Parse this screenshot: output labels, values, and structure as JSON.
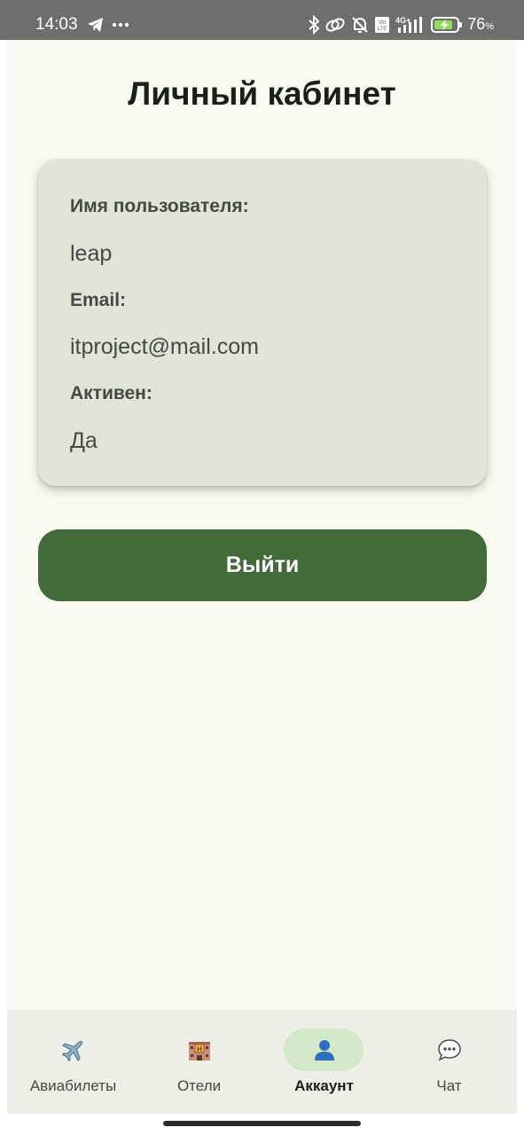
{
  "status_bar": {
    "time": "14:03",
    "left_icons": [
      "telegram-icon",
      "more-dots-icon"
    ],
    "right_icons": [
      "bluetooth-icon",
      "link-icon",
      "notifications-off-icon",
      "volte-icon",
      "signal-4g-icon",
      "battery-charging-icon"
    ],
    "network_badge": "4G+",
    "volte_badge": "Vo LTE",
    "battery_percent": "76",
    "battery_percent_sign": "%"
  },
  "page": {
    "title": "Личный кабинет"
  },
  "profile": {
    "username_label": "Имя пользователя:",
    "username_value": "leap",
    "email_label": "Email:",
    "email_value": "itproject@mail.com",
    "active_label": "Активен:",
    "active_value": "Да"
  },
  "actions": {
    "logout_label": "Выйти"
  },
  "bottom_nav": {
    "items": [
      {
        "label": "Авиабилеты",
        "icon": "airplane-icon",
        "active": false
      },
      {
        "label": "Отели",
        "icon": "hotel-icon",
        "active": false
      },
      {
        "label": "Аккаунт",
        "icon": "user-icon",
        "active": true
      },
      {
        "label": "Чат",
        "icon": "chat-bubble-icon",
        "active": false
      }
    ]
  },
  "colors": {
    "background": "#f8f9f0",
    "card": "#e1e3d9",
    "primary_button": "#436a39",
    "active_nav_pill": "#d3e8c8",
    "nav_bar": "#edeee5",
    "status_bar": "#6e6e6e"
  }
}
